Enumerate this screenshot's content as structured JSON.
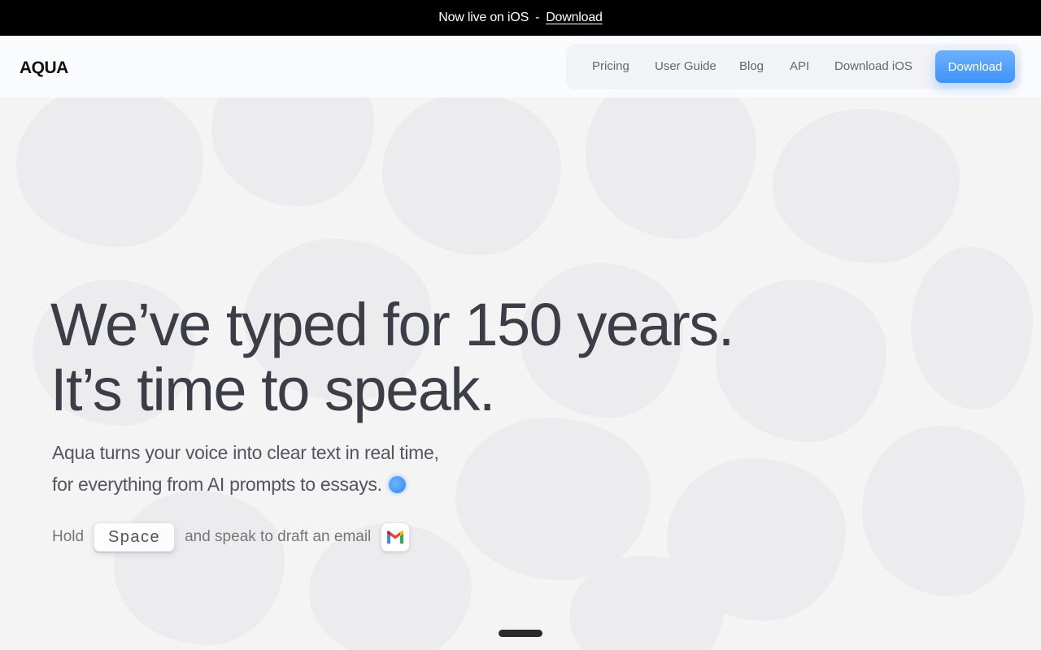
{
  "announcement": {
    "text": "Now live on iOS",
    "separator": "-",
    "link": "Download"
  },
  "header": {
    "logo": "AQUA",
    "nav": {
      "pricing": "Pricing",
      "user_guide": "User Guide",
      "blog": "Blog",
      "api": "API",
      "download_ios": "Download iOS",
      "download_button": "Download"
    }
  },
  "hero": {
    "title_line1": "We’ve typed for 150 years.",
    "title_line2": "It’s time to speak.",
    "subtitle_line1": "Aqua turns your voice into clear text in real time,",
    "subtitle_line2": "for everything from AI prompts to essays.",
    "hold_label": "Hold",
    "key_label": "Space",
    "action_text": "and speak to draft an email",
    "app_icon": "gmail-icon"
  },
  "colors": {
    "accent": "#3f93f8",
    "announcement_bg": "#000000",
    "title_text": "#3d3d48"
  }
}
